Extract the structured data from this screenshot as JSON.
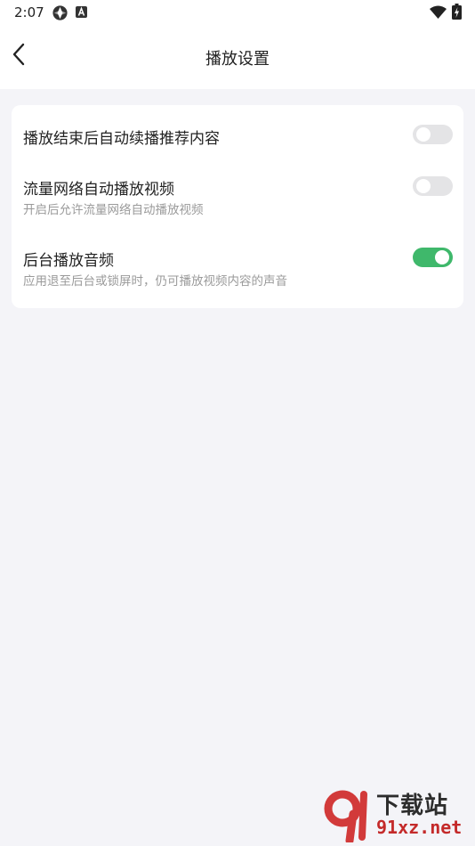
{
  "status_bar": {
    "time": "2:07",
    "icons": [
      "vpn-icon",
      "notification-a-icon",
      "wifi-icon",
      "battery-charging-icon"
    ]
  },
  "header": {
    "title": "播放设置",
    "back_icon": "chevron-left-icon"
  },
  "settings": [
    {
      "title": "播放结束后自动续播推荐内容",
      "subtitle": "",
      "enabled": false
    },
    {
      "title": "流量网络自动播放视频",
      "subtitle": "开启后允许流量网络自动播放视频",
      "enabled": false
    },
    {
      "title": "后台播放音频",
      "subtitle": "应用退至后台或锁屏时，仍可播放视频内容的声音",
      "enabled": true
    }
  ],
  "colors": {
    "toggle_on": "#3fb86b",
    "toggle_off": "#e4e4e6",
    "page_bg": "#f4f4f8"
  },
  "watermark": {
    "line1": "下载站",
    "line2": "91xz.net"
  }
}
